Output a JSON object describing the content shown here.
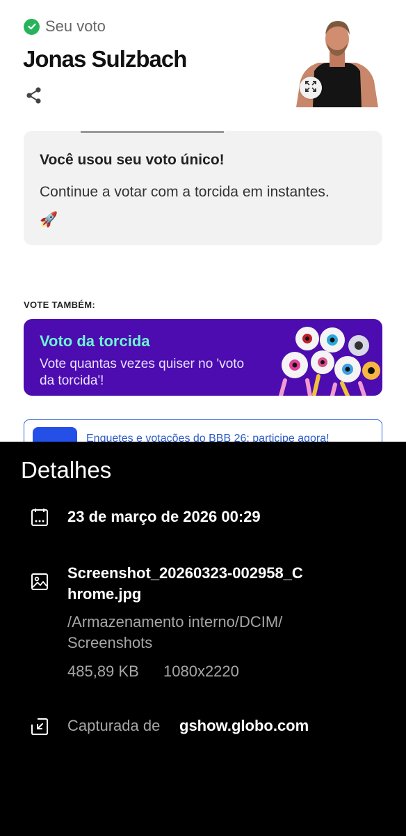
{
  "vote": {
    "status_label": "Seu voto",
    "candidate_name": "Jonas Sulzbach"
  },
  "info_card": {
    "title": "Você usou seu voto único!",
    "text": "Continue a votar com a torcida em instantes. 🚀"
  },
  "also_vote": {
    "label": "VOTE TAMBÉM:"
  },
  "crowd_banner": {
    "title": "Voto da torcida",
    "text": "Vote quantas vezes quiser no 'voto da torcida'!"
  },
  "poll_card": {
    "text": "Enquetes e votações do BBB 26: participe agora!"
  },
  "details": {
    "title": "Detalhes",
    "date": "23 de março de 2026 00:29",
    "file_name": "Screenshot_20260323-002958_Chrome.jpg",
    "file_path": "/Armazenamento interno/DCIM/ Screenshots",
    "file_size": "485,89 KB",
    "resolution": "1080x2220",
    "captured_label": "Capturada de",
    "captured_value": "gshow.globo.com"
  },
  "colors": {
    "check": "#26b35b",
    "banner_bg": "#4c0cb0",
    "banner_title": "#6ef3d4",
    "poll_border": "#2c66d8"
  },
  "icons": {
    "status": "check-circle-icon",
    "share": "share-icon",
    "expand": "expand-icon",
    "calendar": "calendar-icon",
    "image": "image-icon",
    "capture": "capture-source-icon"
  }
}
